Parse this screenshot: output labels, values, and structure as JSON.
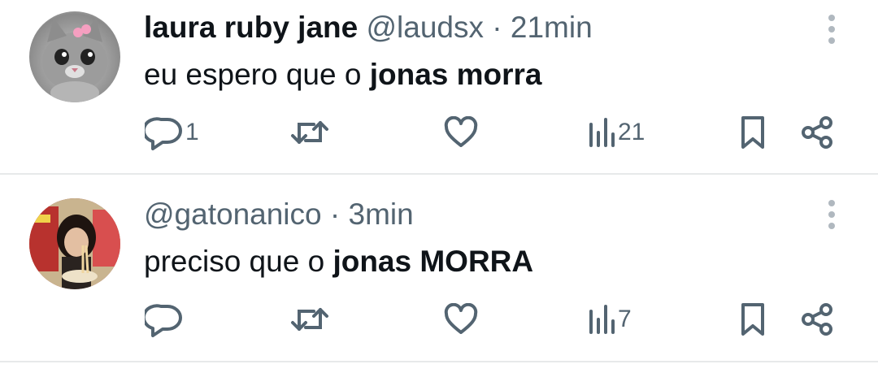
{
  "tweets": [
    {
      "name": "laura ruby jane",
      "handle": "@laudsx",
      "separator": "·",
      "time": "21min",
      "text_prefix": "eu espero que o ",
      "text_bold": "jonas morra",
      "replies": "1",
      "views": "21"
    },
    {
      "name": "",
      "handle": "@gatonanico",
      "separator": "·",
      "time": "3min",
      "text_prefix": "preciso que o ",
      "text_bold": "jonas MORRA",
      "replies": "",
      "views": "7"
    }
  ],
  "colors": {
    "text": "#0f1419",
    "secondary": "#536471",
    "divider": "#e7e9ea"
  },
  "icons": [
    "more-icon",
    "reply-icon",
    "retweet-icon",
    "like-icon",
    "views-icon",
    "bookmark-icon",
    "share-icon"
  ]
}
